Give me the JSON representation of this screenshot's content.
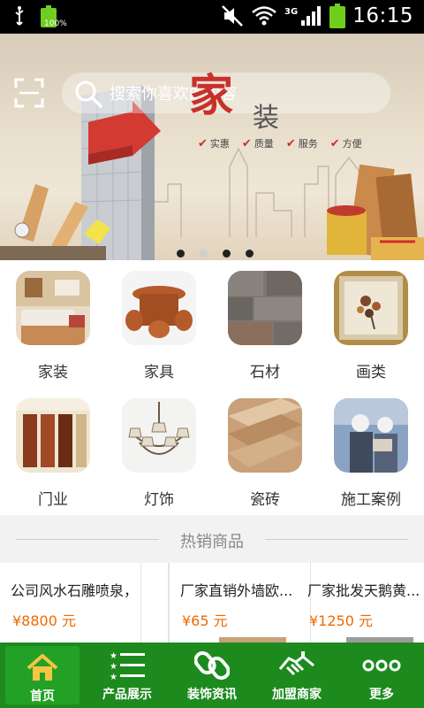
{
  "status_bar": {
    "time": "16:15",
    "battery_left_pct": "100%",
    "network": "3G"
  },
  "banner": {
    "search_placeholder": "搜索你喜欢的内容",
    "headline_char1": "家",
    "headline_char2": "装",
    "tags": [
      "实惠",
      "质量",
      "服务",
      "方便"
    ],
    "slide_count": 4,
    "active_slide": 2
  },
  "categories": [
    {
      "label": "家装",
      "icon": "living-room-thumb"
    },
    {
      "label": "家具",
      "icon": "wood-furniture-thumb"
    },
    {
      "label": "石材",
      "icon": "stone-thumb"
    },
    {
      "label": "画类",
      "icon": "painting-thumb"
    },
    {
      "label": "门业",
      "icon": "doors-thumb"
    },
    {
      "label": "灯饰",
      "icon": "chandelier-thumb"
    },
    {
      "label": "瓷砖",
      "icon": "tiles-thumb"
    },
    {
      "label": "施工案例",
      "icon": "construction-thumb"
    }
  ],
  "hot": {
    "title": "热销商品"
  },
  "products": [
    {
      "name": "公司风水石雕喷泉，...",
      "price": "¥8800 元"
    },
    {
      "name": "厂家直销外墙欧...",
      "price": "¥65 元"
    },
    {
      "name": "厂家批发天鹅黄...",
      "price": "¥1250 元"
    }
  ],
  "nav": [
    {
      "label": "首页",
      "icon": "home-icon",
      "active": true
    },
    {
      "label": "产品展示",
      "icon": "list-icon",
      "active": false
    },
    {
      "label": "装饰资讯",
      "icon": "link-icon",
      "active": false
    },
    {
      "label": "加盟商家",
      "icon": "handshake-icon",
      "active": false
    },
    {
      "label": "更多",
      "icon": "more-icon",
      "active": false
    }
  ],
  "colors": {
    "nav_bg": "#1d8a1e",
    "nav_active": "#23a026",
    "price": "#f06a00",
    "accent_red": "#c8302c"
  }
}
